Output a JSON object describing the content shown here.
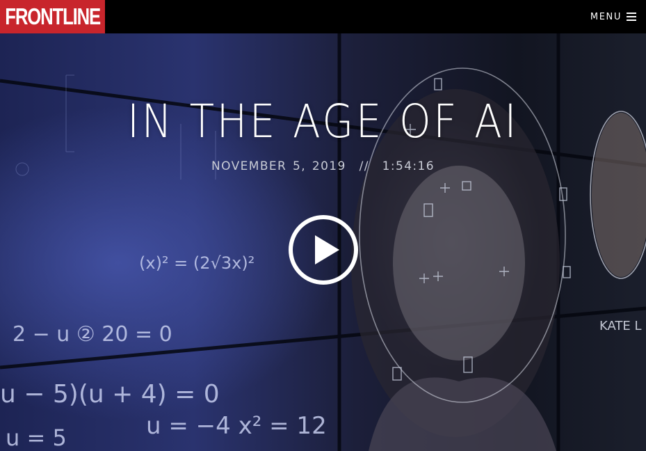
{
  "header": {
    "logo_text": "FRONTLINE",
    "menu_label": "MENU",
    "menu_icon": "hamburger-icon",
    "logo_color": "#c8252c"
  },
  "hero": {
    "title": "IN THE AGE OF AI",
    "date": "November 5, 2019",
    "separator": "//",
    "duration": "1:54:16",
    "play_icon": "play-icon",
    "background_text": {
      "eq1": "(x)² = (2√3x)²",
      "eq2": "2 − u ② 20 = 0",
      "eq3": "u − 5)(u + 4) = 0",
      "eq4": "u = −4   x² = 12",
      "eq5": "u = 5",
      "nametag": "KATE L"
    }
  }
}
